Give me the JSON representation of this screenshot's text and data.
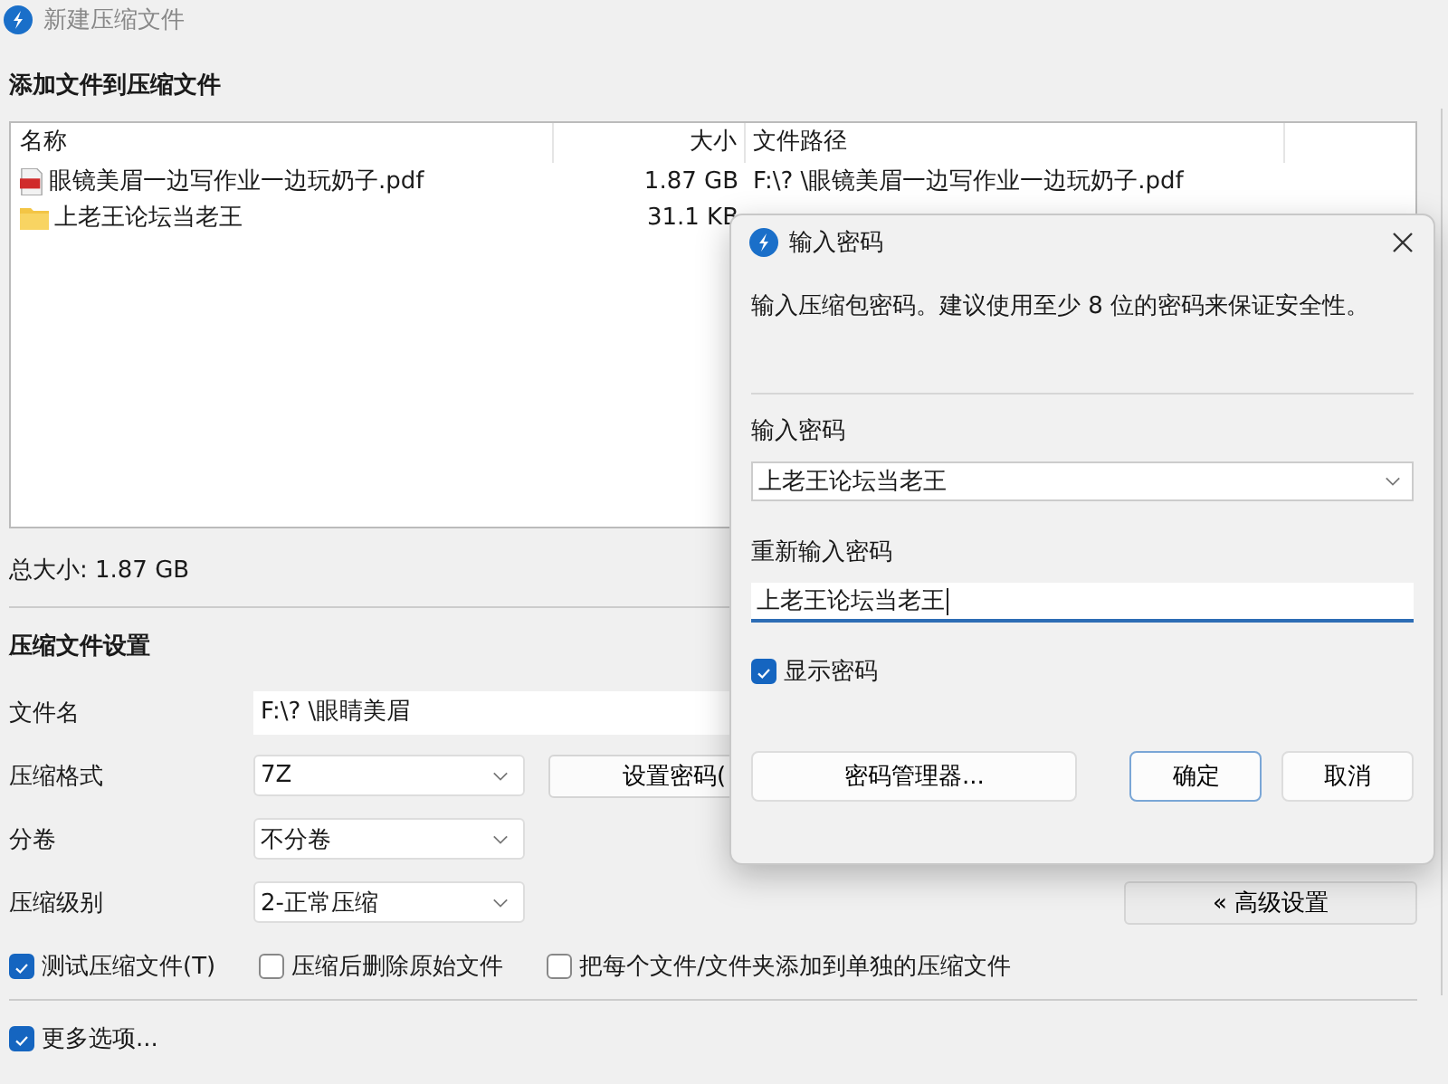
{
  "window": {
    "title": "新建压缩文件"
  },
  "files_section": {
    "heading": "添加文件到压缩文件",
    "columns": [
      "名称",
      "大小",
      "文件路径"
    ],
    "rows": [
      {
        "kind": "pdf",
        "name": "眼镜美眉一边写作业一边玩奶子.pdf",
        "size": "1.87 GB",
        "path": "F:\\? \\眼镜美眉一边写作业一边玩奶子.pdf"
      },
      {
        "kind": "folder",
        "name": "上老王论坛当老王",
        "size": "31.1 KB"
      }
    ],
    "total": "总大小: 1.87 GB"
  },
  "settings": {
    "heading": "压缩文件设置",
    "filename_label": "文件名",
    "filename_value": "F:\\? \\眼睛美眉",
    "format_label": "压缩格式",
    "format_value": "7Z",
    "password_button": "设置密码(",
    "split_label": "分卷",
    "split_value": "不分卷",
    "level_label": "压缩级别",
    "level_value": "2-正常压缩",
    "advanced_button": "« 高级设置"
  },
  "options": [
    {
      "label": "测试压缩文件(T)",
      "checked": true
    },
    {
      "label": "压缩后删除原始文件",
      "checked": false
    },
    {
      "label": "把每个文件/文件夹添加到单独的压缩文件",
      "checked": false
    }
  ],
  "more_options": {
    "label": "更多选项...",
    "checked": true
  },
  "dialog": {
    "title": "输入密码",
    "message": "输入压缩包密码。建议使用至少 8 位的密码来保证安全性。",
    "password_label": "输入密码",
    "password_value": "上老王论坛当老王",
    "confirm_label": "重新输入密码",
    "confirm_value": "上老王论坛当老王",
    "show_password": {
      "label": "显示密码",
      "checked": true
    },
    "buttons": [
      {
        "label": "密码管理器...",
        "kind": "manager"
      },
      {
        "label": "确定",
        "kind": "default"
      },
      {
        "label": "取消",
        "kind": "normal"
      }
    ]
  }
}
